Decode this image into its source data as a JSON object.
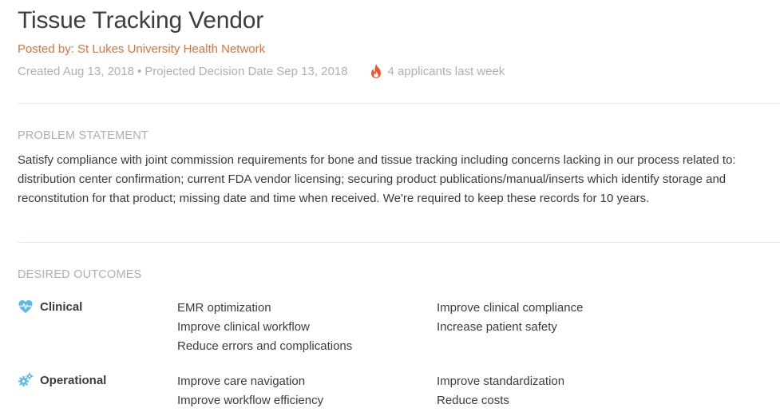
{
  "header": {
    "title": "Tissue Tracking Vendor",
    "posted_by": "Posted by: St Lukes University Health Network",
    "created": "Created Aug 13, 2018",
    "separator": "•",
    "projected_decision": "Projected Decision Date Sep 13, 2018",
    "applicants": "4 applicants last week",
    "flame_icon": "flame-icon"
  },
  "problem": {
    "label": "PROBLEM STATEMENT",
    "text": "Satisfy compliance with joint commission requirements for bone and tissue tracking including concerns lacking in our process related to: distribution center confirmation; current FDA vendor licensing; securing product publications/manual/inserts which identify storage and reconstitution for that product; missing date and time when received. We're required to keep these records for 10 years."
  },
  "outcomes": {
    "label": "DESIRED OUTCOMES",
    "categories": [
      {
        "name": "Clinical",
        "icon": "heart-pulse-icon",
        "column_a": [
          "EMR optimization",
          "Improve clinical workflow",
          "Reduce errors and complications"
        ],
        "column_b": [
          "Improve clinical compliance",
          "Increase patient safety"
        ]
      },
      {
        "name": "Operational",
        "icon": "gears-icon",
        "column_a": [
          "Improve care navigation",
          "Improve workflow efficiency"
        ],
        "column_b": [
          "Improve standardization",
          "Reduce costs"
        ]
      }
    ]
  },
  "colors": {
    "accent_orange": "#e5703a",
    "muted_text": "#a9b2b9",
    "icon_blue": "#5bb8ea",
    "flame_red": "#f0542a"
  }
}
